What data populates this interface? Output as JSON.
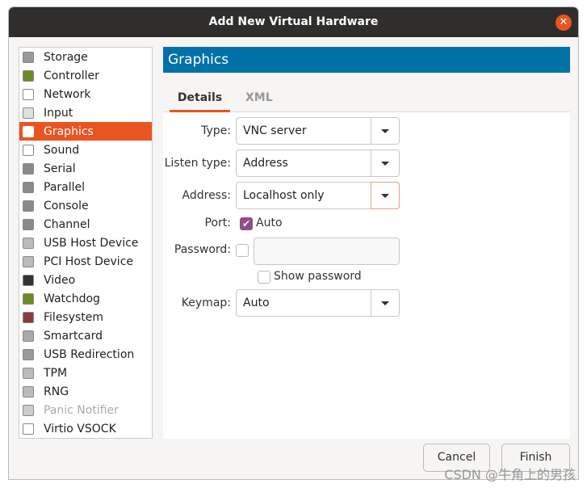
{
  "window": {
    "title": "Add New Virtual Hardware",
    "close_icon": "close-icon"
  },
  "sidebar": {
    "items": [
      {
        "label": "Storage",
        "icon": "storage-icon",
        "color": "#9a9a9a"
      },
      {
        "label": "Controller",
        "icon": "controller-icon",
        "color": "#6b8e23"
      },
      {
        "label": "Network",
        "icon": "network-icon",
        "color": "#ffffff"
      },
      {
        "label": "Input",
        "icon": "mouse-icon",
        "color": "#e0e0e0"
      },
      {
        "label": "Graphics",
        "icon": "monitor-icon",
        "color": "#ffffff",
        "selected": true
      },
      {
        "label": "Sound",
        "icon": "sound-icon",
        "color": "#ffffff"
      },
      {
        "label": "Serial",
        "icon": "serial-icon",
        "color": "#8a8a8a"
      },
      {
        "label": "Parallel",
        "icon": "parallel-icon",
        "color": "#8a8a8a"
      },
      {
        "label": "Console",
        "icon": "console-icon",
        "color": "#8a8a8a"
      },
      {
        "label": "Channel",
        "icon": "channel-icon",
        "color": "#8a8a8a"
      },
      {
        "label": "USB Host Device",
        "icon": "usb-gear-icon",
        "color": "#bbbbbb"
      },
      {
        "label": "PCI Host Device",
        "icon": "pci-gear-icon",
        "color": "#bbbbbb"
      },
      {
        "label": "Video",
        "icon": "video-icon",
        "color": "#333333"
      },
      {
        "label": "Watchdog",
        "icon": "watchdog-icon",
        "color": "#6b8e23"
      },
      {
        "label": "Filesystem",
        "icon": "folder-icon",
        "color": "#8b3a3a"
      },
      {
        "label": "Smartcard",
        "icon": "smartcard-icon",
        "color": "#aaaaaa"
      },
      {
        "label": "USB Redirection",
        "icon": "usb-redirection-icon",
        "color": "#999999"
      },
      {
        "label": "TPM",
        "icon": "chip-icon",
        "color": "#bbbbbb"
      },
      {
        "label": "RNG",
        "icon": "rng-gear-icon",
        "color": "#bbbbbb"
      },
      {
        "label": "Panic Notifier",
        "icon": "panic-gear-icon",
        "color": "#cccccc",
        "disabled": true
      },
      {
        "label": "Virtio VSOCK",
        "icon": "vsock-icon",
        "color": "#ffffff"
      }
    ]
  },
  "header": {
    "title": "Graphics"
  },
  "tabs": [
    {
      "label": "Details",
      "active": true
    },
    {
      "label": "XML",
      "active": false
    }
  ],
  "form": {
    "type": {
      "label": "Type:",
      "value": "VNC server"
    },
    "listen_type": {
      "label": "Listen type:",
      "value": "Address"
    },
    "address": {
      "label": "Address:",
      "value": "Localhost only"
    },
    "port": {
      "label": "Port:",
      "auto_label": "Auto",
      "auto_checked": true
    },
    "password": {
      "label": "Password:",
      "checked": false,
      "value": ""
    },
    "show_password": {
      "label": "Show password",
      "checked": false
    },
    "keymap": {
      "label": "Keymap:",
      "value": "Auto"
    }
  },
  "buttons": {
    "cancel": "Cancel",
    "finish": "Finish"
  },
  "watermark": "CSDN @牛角上的男孩",
  "colors": {
    "accent": "#e95420",
    "header": "#0072a8",
    "checkbox": "#924d8b",
    "titlebar": "#2f2e2c"
  }
}
